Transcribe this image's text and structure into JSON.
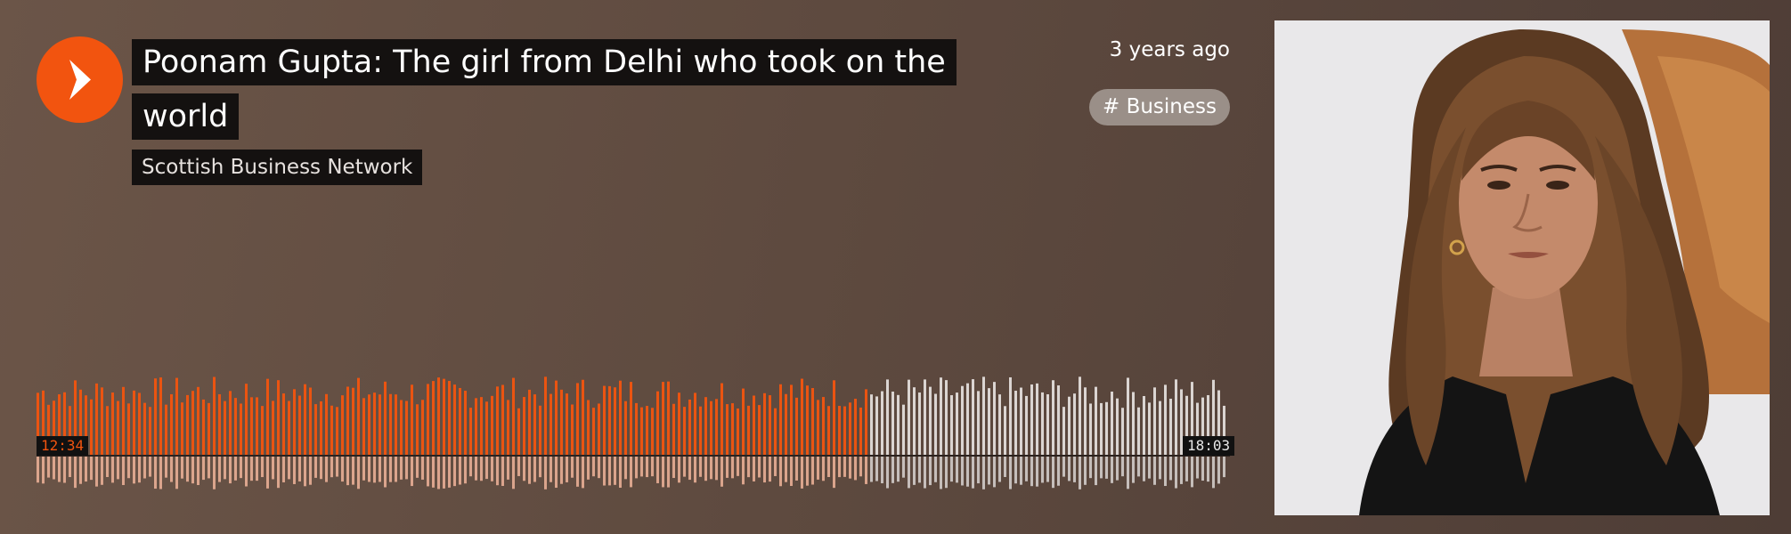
{
  "track": {
    "title": "Poonam Gupta: The girl from Delhi who took on the world",
    "author": "Scottish Business Network",
    "posted": "3 years ago",
    "tag": "# Business"
  },
  "player": {
    "current_time": "12:34",
    "duration": "18:03",
    "progress_fraction": 0.697,
    "played_color": "#f2540f",
    "unplayed_color": "#ffffff"
  },
  "artwork": {
    "background_color": "#e9e8ea",
    "chair_color": "#b5713b"
  },
  "icons": {
    "play": "play-icon"
  }
}
